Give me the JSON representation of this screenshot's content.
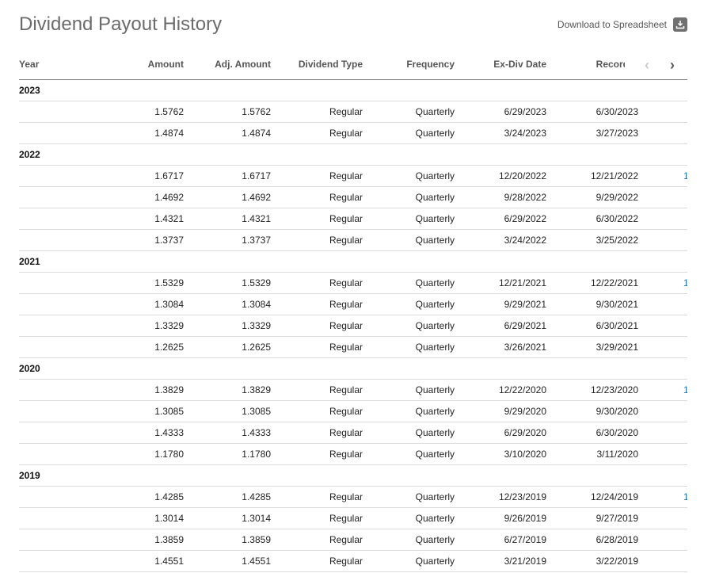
{
  "title": "Dividend Payout History",
  "download_label": "Download to Spreadsheet",
  "icons": {
    "download": "download-icon",
    "prev": "chevron-left-icon",
    "next": "chevron-right-icon"
  },
  "colors": {
    "title": "#6b6b6b",
    "link": "#1a73c8",
    "header_border": "#7a7f7f"
  },
  "columns": [
    "Year",
    "Amount",
    "Adj. Amount",
    "Dividend Type",
    "Frequency",
    "Ex-Div Date",
    "Record D"
  ],
  "groups": [
    {
      "year": "2023",
      "rows": [
        [
          "1.5762",
          "1.5762",
          "Regular",
          "Quarterly",
          "6/29/2023",
          "6/30/2023",
          ""
        ],
        [
          "1.4874",
          "1.4874",
          "Regular",
          "Quarterly",
          "3/24/2023",
          "3/27/2023",
          ""
        ]
      ]
    },
    {
      "year": "2022",
      "rows": [
        [
          "1.6717",
          "1.6717",
          "Regular",
          "Quarterly",
          "12/20/2022",
          "12/21/2022",
          "1"
        ],
        [
          "1.4692",
          "1.4692",
          "Regular",
          "Quarterly",
          "9/28/2022",
          "9/29/2022",
          ""
        ],
        [
          "1.4321",
          "1.4321",
          "Regular",
          "Quarterly",
          "6/29/2022",
          "6/30/2022",
          ""
        ],
        [
          "1.3737",
          "1.3737",
          "Regular",
          "Quarterly",
          "3/24/2022",
          "3/25/2022",
          ""
        ]
      ]
    },
    {
      "year": "2021",
      "rows": [
        [
          "1.5329",
          "1.5329",
          "Regular",
          "Quarterly",
          "12/21/2021",
          "12/22/2021",
          "1"
        ],
        [
          "1.3084",
          "1.3084",
          "Regular",
          "Quarterly",
          "9/29/2021",
          "9/30/2021",
          ""
        ],
        [
          "1.3329",
          "1.3329",
          "Regular",
          "Quarterly",
          "6/29/2021",
          "6/30/2021",
          ""
        ],
        [
          "1.2625",
          "1.2625",
          "Regular",
          "Quarterly",
          "3/26/2021",
          "3/29/2021",
          ""
        ]
      ]
    },
    {
      "year": "2020",
      "rows": [
        [
          "1.3829",
          "1.3829",
          "Regular",
          "Quarterly",
          "12/22/2020",
          "12/23/2020",
          "1"
        ],
        [
          "1.3085",
          "1.3085",
          "Regular",
          "Quarterly",
          "9/29/2020",
          "9/30/2020",
          ""
        ],
        [
          "1.4333",
          "1.4333",
          "Regular",
          "Quarterly",
          "6/29/2020",
          "6/30/2020",
          ""
        ],
        [
          "1.1780",
          "1.1780",
          "Regular",
          "Quarterly",
          "3/10/2020",
          "3/11/2020",
          ""
        ]
      ]
    },
    {
      "year": "2019",
      "rows": [
        [
          "1.4285",
          "1.4285",
          "Regular",
          "Quarterly",
          "12/23/2019",
          "12/24/2019",
          "1"
        ],
        [
          "1.3014",
          "1.3014",
          "Regular",
          "Quarterly",
          "9/26/2019",
          "9/27/2019",
          ""
        ],
        [
          "1.3859",
          "1.3859",
          "Regular",
          "Quarterly",
          "6/27/2019",
          "6/28/2019",
          ""
        ],
        [
          "1.4551",
          "1.4551",
          "Regular",
          "Quarterly",
          "3/21/2019",
          "3/22/2019",
          ""
        ]
      ]
    }
  ]
}
